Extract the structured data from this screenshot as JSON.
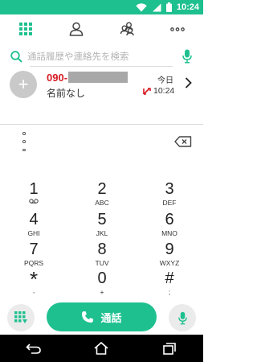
{
  "status_bar": {
    "time": "10:24"
  },
  "tabs": [
    {
      "name": "dialpad-tab",
      "active": true
    },
    {
      "name": "contacts-tab",
      "active": false
    },
    {
      "name": "groups-tab",
      "active": false
    },
    {
      "name": "more-tab",
      "active": false
    }
  ],
  "search": {
    "placeholder": "通話履歴や連絡先を検索",
    "value": ""
  },
  "call_log": [
    {
      "number": "090-",
      "name": "名前なし",
      "date": "今日",
      "time": "10:24",
      "type": "missed-outgoing"
    }
  ],
  "keypad": [
    {
      "digit": "1",
      "letters": ""
    },
    {
      "digit": "2",
      "letters": "ABC"
    },
    {
      "digit": "3",
      "letters": "DEF"
    },
    {
      "digit": "4",
      "letters": "GHI"
    },
    {
      "digit": "5",
      "letters": "JKL"
    },
    {
      "digit": "6",
      "letters": "MNO"
    },
    {
      "digit": "7",
      "letters": "PQRS"
    },
    {
      "digit": "8",
      "letters": "TUV"
    },
    {
      "digit": "9",
      "letters": "WXYZ"
    },
    {
      "digit": "*",
      "letters": ","
    },
    {
      "digit": "0",
      "letters": "+"
    },
    {
      "digit": "#",
      "letters": ";"
    }
  ],
  "call_button": {
    "label": "通話"
  },
  "colors": {
    "accent": "#1fc08f",
    "missed": "#d81b25"
  }
}
